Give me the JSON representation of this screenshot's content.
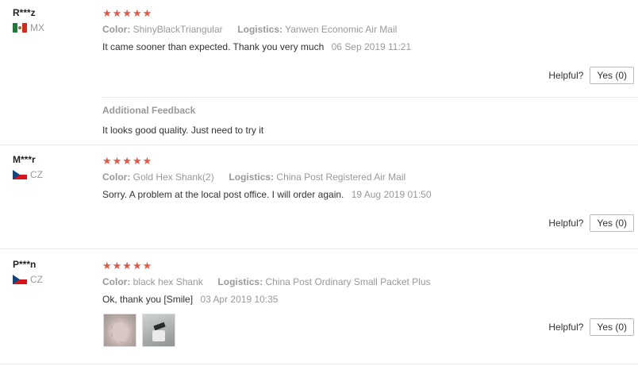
{
  "labels": {
    "color": "Color:",
    "logistics": "Logistics:",
    "helpful": "Helpful?",
    "yes_button": "Yes (0)",
    "additional_feedback": "Additional Feedback"
  },
  "colors": {
    "star": "#e05a47",
    "muted_text": "#999999",
    "body_text": "#333333"
  },
  "reviews": [
    {
      "user": "R***z",
      "country": "MX",
      "flag_icon": "flag-mexico-icon",
      "stars": "★★★★★",
      "rating": 5,
      "color_value": "ShinyBlackTriangular",
      "logistics_value": "Yanwen Economic Air Mail",
      "text": "It came sooner than expected. Thank you very much",
      "date": "06 Sep 2019 11:21",
      "additional_feedback": "It looks good quality. Just need to try it"
    },
    {
      "user": "M***r",
      "country": "CZ",
      "flag_icon": "flag-czech-icon",
      "stars": "★★★★★",
      "rating": 5,
      "color_value": "Gold Hex Shank(2)",
      "logistics_value": "China Post Registered Air Mail",
      "text": "Sorry. A problem at the local post office. I will order again.",
      "date": "19 Aug 2019 01:50"
    },
    {
      "user": "P***n",
      "country": "CZ",
      "flag_icon": "flag-czech-icon",
      "stars": "★★★★★",
      "rating": 5,
      "color_value": "black hex Shank",
      "logistics_value": "China Post Ordinary Small Packet Plus",
      "text": "Ok, thank you [Smile]",
      "date": "03 Apr 2019 10:35",
      "photos": [
        "review-photo-1",
        "review-photo-2"
      ]
    }
  ]
}
